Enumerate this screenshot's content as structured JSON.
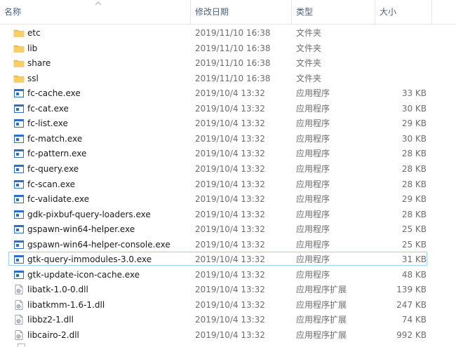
{
  "header": {
    "name": "名称",
    "date": "修改日期",
    "type": "类型",
    "size": "大小"
  },
  "colors": {
    "folder": "#f2c14e",
    "exe_blue": "#2a6fc9",
    "hover_border": "#99d1ff"
  },
  "files": [
    {
      "name": "etc",
      "date": "2019/11/10 16:38",
      "type": "文件夹",
      "size": "",
      "icon": "folder-icon"
    },
    {
      "name": "lib",
      "date": "2019/11/10 16:38",
      "type": "文件夹",
      "size": "",
      "icon": "folder-icon"
    },
    {
      "name": "share",
      "date": "2019/11/10 16:38",
      "type": "文件夹",
      "size": "",
      "icon": "folder-icon"
    },
    {
      "name": "ssl",
      "date": "2019/11/10 16:38",
      "type": "文件夹",
      "size": "",
      "icon": "folder-icon"
    },
    {
      "name": "fc-cache.exe",
      "date": "2019/10/4 13:32",
      "type": "应用程序",
      "size": "33 KB",
      "icon": "exe-icon"
    },
    {
      "name": "fc-cat.exe",
      "date": "2019/10/4 13:32",
      "type": "应用程序",
      "size": "30 KB",
      "icon": "exe-icon"
    },
    {
      "name": "fc-list.exe",
      "date": "2019/10/4 13:32",
      "type": "应用程序",
      "size": "29 KB",
      "icon": "exe-icon"
    },
    {
      "name": "fc-match.exe",
      "date": "2019/10/4 13:32",
      "type": "应用程序",
      "size": "30 KB",
      "icon": "exe-icon"
    },
    {
      "name": "fc-pattern.exe",
      "date": "2019/10/4 13:32",
      "type": "应用程序",
      "size": "28 KB",
      "icon": "exe-icon"
    },
    {
      "name": "fc-query.exe",
      "date": "2019/10/4 13:32",
      "type": "应用程序",
      "size": "28 KB",
      "icon": "exe-icon"
    },
    {
      "name": "fc-scan.exe",
      "date": "2019/10/4 13:32",
      "type": "应用程序",
      "size": "28 KB",
      "icon": "exe-icon"
    },
    {
      "name": "fc-validate.exe",
      "date": "2019/10/4 13:32",
      "type": "应用程序",
      "size": "29 KB",
      "icon": "exe-icon"
    },
    {
      "name": "gdk-pixbuf-query-loaders.exe",
      "date": "2019/10/4 13:32",
      "type": "应用程序",
      "size": "28 KB",
      "icon": "exe-icon"
    },
    {
      "name": "gspawn-win64-helper.exe",
      "date": "2019/10/4 13:32",
      "type": "应用程序",
      "size": "25 KB",
      "icon": "exe-icon"
    },
    {
      "name": "gspawn-win64-helper-console.exe",
      "date": "2019/10/4 13:32",
      "type": "应用程序",
      "size": "25 KB",
      "icon": "exe-icon"
    },
    {
      "name": "gtk-query-immodules-3.0.exe",
      "date": "2019/10/4 13:32",
      "type": "应用程序",
      "size": "31 KB",
      "icon": "exe-icon",
      "hover": true
    },
    {
      "name": "gtk-update-icon-cache.exe",
      "date": "2019/10/4 13:32",
      "type": "应用程序",
      "size": "48 KB",
      "icon": "exe-icon"
    },
    {
      "name": "libatk-1.0-0.dll",
      "date": "2019/10/4 13:32",
      "type": "应用程序扩展",
      "size": "139 KB",
      "icon": "dll-icon"
    },
    {
      "name": "libatkmm-1.6-1.dll",
      "date": "2019/10/4 13:32",
      "type": "应用程序扩展",
      "size": "247 KB",
      "icon": "dll-icon"
    },
    {
      "name": "libbz2-1.dll",
      "date": "2019/10/4 13:32",
      "type": "应用程序扩展",
      "size": "74 KB",
      "icon": "dll-icon"
    },
    {
      "name": "libcairo-2.dll",
      "date": "2019/10/4 13:32",
      "type": "应用程序扩展",
      "size": "992 KB",
      "icon": "dll-icon"
    }
  ]
}
